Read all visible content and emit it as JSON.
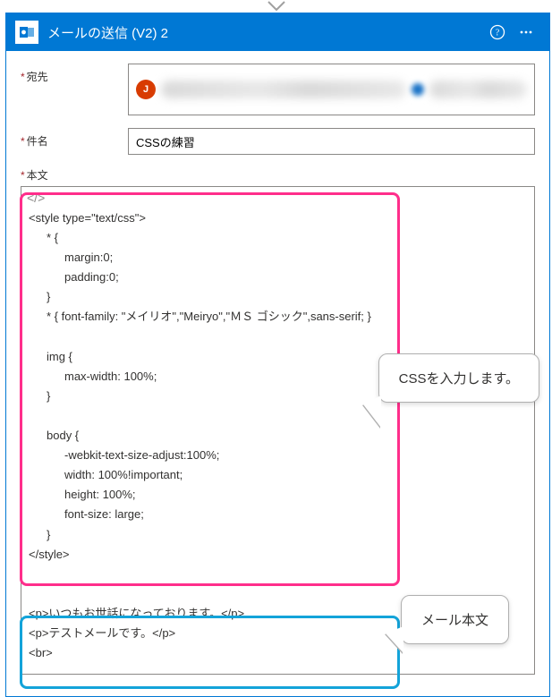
{
  "header": {
    "title": "メールの送信 (V2) 2",
    "icon_name": "outlook-icon",
    "help_icon": "help-icon",
    "more_icon": "more-icon"
  },
  "fields": {
    "to_label": "宛先",
    "to_avatar_initial": "J",
    "subject_label": "件名",
    "subject_value": "CSSの練習",
    "body_label": "本文",
    "code_toggle_glyph": "</>"
  },
  "body_lines": [
    {
      "t": "<style type=\"text/css\">",
      "i": 0
    },
    {
      "t": "* {",
      "i": 1
    },
    {
      "t": "margin:0;",
      "i": 2
    },
    {
      "t": "padding:0;",
      "i": 2
    },
    {
      "t": "}",
      "i": 1
    },
    {
      "t": "* { font-family: \"メイリオ\",\"Meiryo\",\"ＭＳ ゴシック\",sans-serif; }",
      "i": 1
    },
    {
      "t": "",
      "i": 0
    },
    {
      "t": "img {",
      "i": 1
    },
    {
      "t": "max-width: 100%;",
      "i": 2
    },
    {
      "t": "}",
      "i": 1
    },
    {
      "t": "",
      "i": 0
    },
    {
      "t": "body {",
      "i": 1
    },
    {
      "t": "-webkit-text-size-adjust:100%;",
      "i": 2
    },
    {
      "t": "width: 100%!important;",
      "i": 2
    },
    {
      "t": "height: 100%;",
      "i": 2
    },
    {
      "t": "font-size: large;",
      "i": 2
    },
    {
      "t": "}",
      "i": 1
    },
    {
      "t": "</style>",
      "i": 0
    },
    {
      "t": "",
      "i": 0
    },
    {
      "t": "",
      "i": 0
    },
    {
      "t": "<p>いつもお世話になっております。</p>",
      "i": 0
    },
    {
      "t": "<p>テストメールです。</p>",
      "i": 0
    },
    {
      "t": "<br>",
      "i": 0
    }
  ],
  "callouts": {
    "css_hint": "CSSを入力します。",
    "body_hint": "メール本文"
  }
}
